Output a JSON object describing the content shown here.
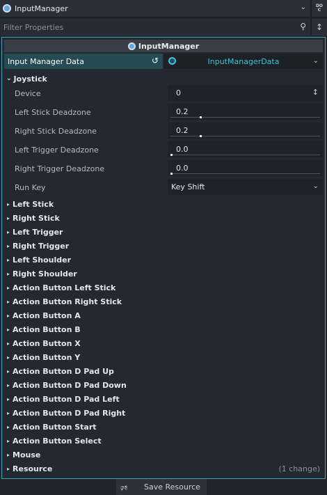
{
  "toolbar": {
    "object_name": "InputManager",
    "doc_label_top": "DO",
    "doc_label_bottom": "C",
    "filter_placeholder": "Filter Properties"
  },
  "panel": {
    "header": "InputManager",
    "resource_label": "Input Manager Data",
    "resource_value": "InputManagerData"
  },
  "joystick": {
    "title": "Joystick",
    "rows": [
      {
        "label": "Device",
        "value": "0"
      },
      {
        "label": "Left Stick Deadzone",
        "value": "0.2"
      },
      {
        "label": "Right Stick Deadzone",
        "value": "0.2"
      },
      {
        "label": "Left Trigger Deadzone",
        "value": "0.0"
      },
      {
        "label": "Right Trigger Deadzone",
        "value": "0.0"
      },
      {
        "label": "Run Key",
        "value": "Key Shift"
      }
    ]
  },
  "sections": [
    "Left Stick",
    "Right Stick",
    "Left Trigger",
    "Right Trigger",
    "Left Shoulder",
    "Right Shoulder",
    "Action Button Left Stick",
    "Action Button Right Stick",
    "Action Button A",
    "Action Button B",
    "Action Button X",
    "Action Button Y",
    "Action Button D Pad Up",
    "Action Button D Pad Down",
    "Action Button D Pad Left",
    "Action Button D Pad Right",
    "Action Button Start",
    "Action Button Select",
    "Mouse",
    "Resource"
  ],
  "resource_changes": "(1 change)",
  "footer": {
    "save_label": "Save Resource"
  },
  "colors": {
    "accent": "#3aa6b4",
    "resource_text": "#44c1d2"
  },
  "icons": {
    "object": "object-icon",
    "doc": "doc-icon",
    "search": "search-icon",
    "filter_options": "tool-icon",
    "revert": "revert-icon",
    "resource": "resource-icon",
    "save": "save-icon"
  }
}
